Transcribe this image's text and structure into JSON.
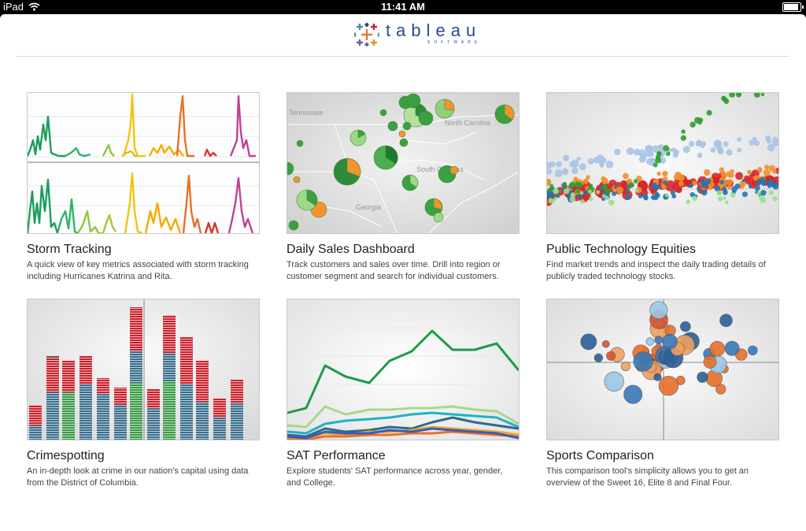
{
  "status_bar": {
    "carrier": "iPad",
    "time": "11:41 AM"
  },
  "brand": {
    "name": "tableau",
    "sub": "SOFTWARE"
  },
  "tiles": [
    {
      "title": "Storm Tracking",
      "desc": "A quick view of key metrics associated with storm tracking including Hurricanes Katrina and Rita."
    },
    {
      "title": "Daily Sales Dashboard",
      "desc": "Track customers and sales over time. Drill into region or customer segment and search for individual customers.",
      "map_labels": [
        "Tennessee",
        "North Carolina",
        "South Carolina",
        "Georgia"
      ]
    },
    {
      "title": "Public Technology Equities",
      "desc": "Find market trends and inspect the daily trading details of publicly traded technology stocks."
    },
    {
      "title": "Crimespotting",
      "desc": "An in-depth look at crime in our nation's capital using data from the District of Columbia."
    },
    {
      "title": "SAT Performance",
      "desc": "Explore students' SAT performance across year, gender, and College."
    },
    {
      "title": "Sports Comparison",
      "desc": "This comparison tool's simplicity allows you to get an overview of the Sweet 16, Elite 8 and Final Four."
    }
  ],
  "colors": {
    "logo_blue": "#2a4b8d",
    "accent_green": "#2ca02c",
    "accent_orange": "#ff7f0e",
    "accent_red": "#d62728",
    "accent_blue": "#1f77b4"
  }
}
